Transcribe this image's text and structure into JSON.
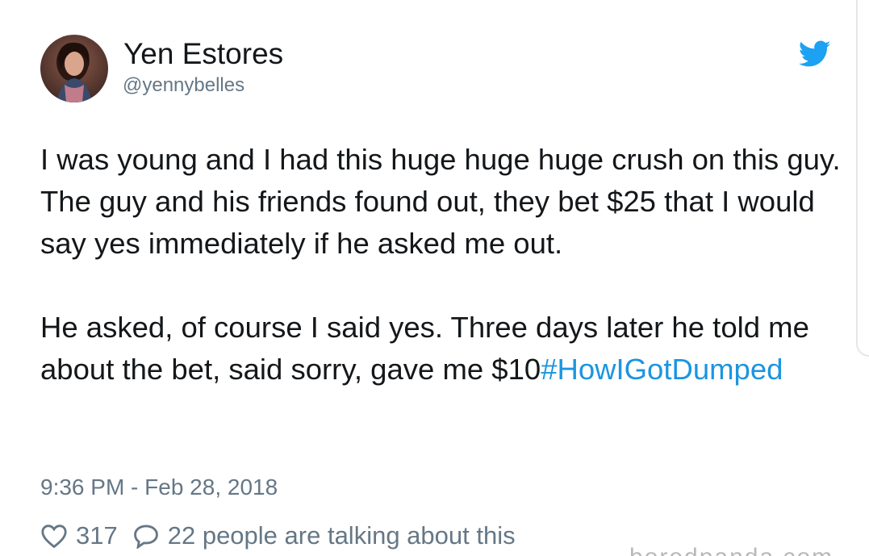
{
  "tweet": {
    "author": {
      "display_name": "Yen Estores",
      "handle": "@yennybelles",
      "avatar_icon": "profile-photo"
    },
    "brand_icon": "twitter-bird-icon",
    "brand_color": "#1da1f2",
    "paragraph1": "I was young and I had this huge huge huge crush on this guy. The guy and his friends found out, they bet $25 that I would say yes immediately if he asked me out.",
    "paragraph2_text": "He asked, of course I said yes. Three days later he told me about the bet, said sorry, gave me $10",
    "hashtag": "#HowIGotDumped",
    "hashtag_color": "#1b95e0",
    "timestamp": "9:36 PM - Feb 28, 2018",
    "like_count": "317",
    "talking_text": "22 people are talking about this",
    "watermark": "boredpanda.com"
  }
}
